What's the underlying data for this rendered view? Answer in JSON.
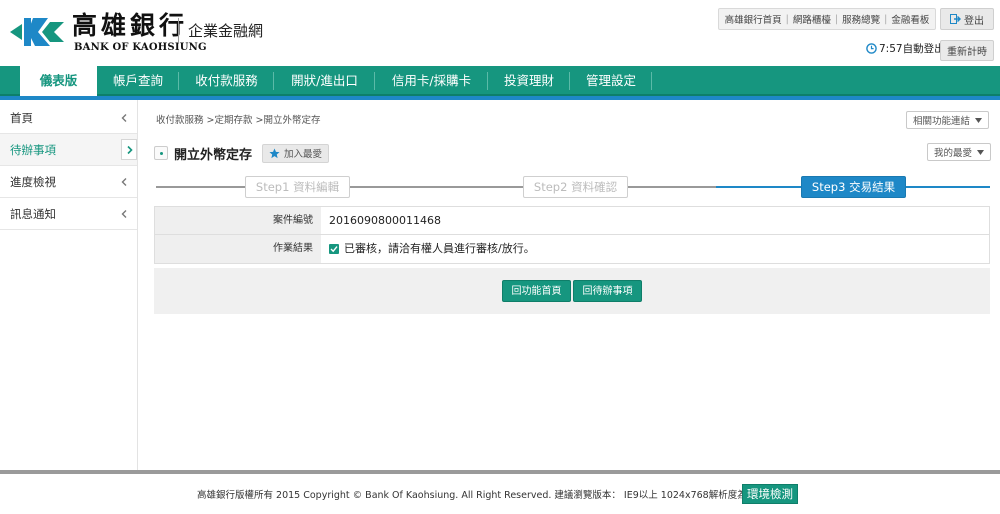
{
  "brand": {
    "name_zh": "高雄銀行",
    "name_en": "BANK OF KAOHSIUNG",
    "portal": "企業金融網",
    "color": "#16967f"
  },
  "header": {
    "top_links": [
      "高雄銀行首頁",
      "網路櫃檯",
      "服務總覽",
      "金融看板"
    ],
    "logout_label": "登出",
    "timer_text": "7:57自動登出",
    "reset_timer_label": "重新計時"
  },
  "nav": {
    "items": [
      "儀表版",
      "帳戶查詢",
      "收付款服務",
      "開狀/進出口",
      "信用卡/採購卡",
      "投資理財",
      "管理設定"
    ],
    "active_index": 0
  },
  "sidebar": {
    "items": [
      "首頁",
      "待辦事項",
      "進度檢視",
      "訊息通知"
    ],
    "active_index": 1
  },
  "breadcrumb": "收付款服務 >定期存款 >開立外幣定存",
  "related_functions_label": "相關功能連結",
  "my_favorites_label": "我的最愛",
  "page_title": "開立外幣定存",
  "add_favorite_label": "加入最愛",
  "steps": {
    "items": [
      "Step1 資料編輯",
      "Step2 資料確認",
      "Step3 交易結果"
    ],
    "current_index": 2,
    "accent_color": "#1e88c7"
  },
  "form": {
    "case_no_label": "案件編號",
    "case_no_value": "2016090800011468",
    "result_label": "作業結果",
    "result_value": "已審核，請洽有權人員進行審核/放行。"
  },
  "actions": {
    "back_home_label": "回功能首頁",
    "back_todo_label": "回待辦事項"
  },
  "footer": {
    "copyright": "高雄銀行版權所有 2015 Copyright © Bank Of Kaohsiung. All Right Reserved. 建議瀏覽版本： IE9以上 1024x768解析度為佳",
    "env_check_label": "環境檢測"
  }
}
